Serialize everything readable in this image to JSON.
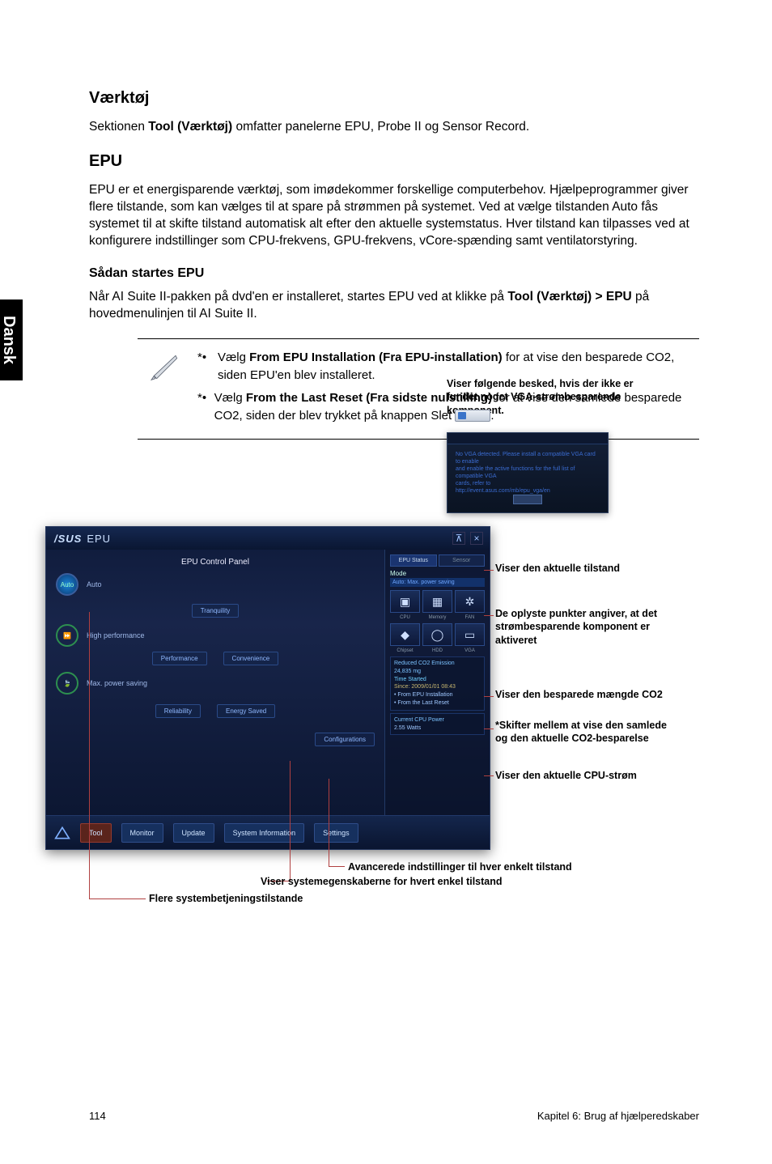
{
  "side_tab": "Dansk",
  "section1": {
    "heading": "Værktøj",
    "body_prefix": "Sektionen ",
    "body_bold": "Tool (Værktøj)",
    "body_suffix": " omfatter panelerne EPU, Probe II og Sensor Record."
  },
  "section2": {
    "heading": "EPU",
    "body": "EPU er et energisparende værktøj, som imødekommer forskellige computerbehov. Hjælpeprogrammer giver flere tilstande, som kan vælges til at spare på strømmen på systemet. Ved at vælge tilstanden Auto fås systemet til at skifte tilstand automatisk alt efter den aktuelle systemstatus. Hver tilstand kan tilpasses ved at konfigurere indstillinger som CPU-frekvens, GPU-frekvens, vCore-spænding samt ventilatorstyring."
  },
  "start": {
    "heading": "Sådan startes EPU",
    "p1_a": "Når AI Suite II-pakken på dvd'en er installeret, startes EPU ved at klikke på ",
    "p1_b": "Tool (Værktøj) > EPU",
    "p1_c": " på hovedmenulinjen til AI Suite II."
  },
  "callouts": {
    "top": "Viser følgende besked, hvis der ikke er fundet noget VGA-strømbesparende komponent.",
    "r1": "Viser den aktuelle tilstand",
    "r2": "De oplyste punkter angiver, at det strømbesparende komponent er aktiveret",
    "r3": "Viser den besparede mængde CO2",
    "r4": "*Skifter mellem at vise den samlede og den aktuelle CO2-besparelse",
    "r5": "Viser den aktuelle CPU-strøm",
    "b1": "Avancerede indstillinger til hver enkelt tilstand",
    "b2": "Viser systemegenskaberne for hvert enkel tilstand",
    "b3": "Flere systembetjeningstilstande"
  },
  "warn": {
    "line1": "No VGA detected. Please install a compatible VGA card to enable",
    "line2": "and enable the active functions for the full list of compatible VGA",
    "line3": "cards, refer to",
    "line4": "http://event.asus.com/mb/epu_vga/en"
  },
  "shot": {
    "brand": "/SUS",
    "title": "EPU",
    "panel_label": "EPU Control Panel",
    "mode_auto": "Auto",
    "mode_high": "High performance",
    "mode_max": "Max. power saving",
    "tag_tranquility": "Tranquility",
    "tag_performance": "Performance",
    "tag_convenience": "Convenience",
    "tag_reliability": "Reliability",
    "tag_energy": "Energy Saved",
    "tag_config": "Configurations",
    "rp_tab1": "EPU Status",
    "rp_tab2": "Sensor",
    "rp_mode": "Mode",
    "rp_auto": "Auto: Max. power saving",
    "rp_cap_cpu": "CPU",
    "rp_cap_mem": "Memory",
    "rp_cap_fan": "FAN",
    "rp_cap_chip": "Chipset",
    "rp_cap_hdd": "HDD",
    "rp_cap_vga": "VGA",
    "rp_co2_label": "Reduced CO2 Emission",
    "rp_co2_val": "24,835 mg",
    "rp_time_label": "Time Started",
    "rp_time_val": "Since: 2009/01/01 08:43",
    "rp_from1": "• From EPU Installation",
    "rp_from2": "• From the Last Reset",
    "rp_cpu_label": "Current CPU Power",
    "rp_cpu_val": "2.55 Watts",
    "bb_tool": "Tool",
    "bb_monitor": "Monitor",
    "bb_update": "Update",
    "bb_sys": "System Information",
    "bb_settings": "Settings"
  },
  "notes": {
    "n1_a": "Vælg ",
    "n1_b": "From EPU Installation (Fra EPU-installation)",
    "n1_c": " for at vise den besparede CO2, siden EPU'en blev installeret.",
    "n2_a": "Vælg ",
    "n2_b": "From the Last Reset (Fra sidste nulstilling)",
    "n2_c": " for at vise den samlede besparede CO2, siden der blev trykket på knappen Slet ",
    "n2_d": "."
  },
  "footer": {
    "page": "114",
    "chapter": "Kapitel 6: Brug af hjælperedskaber"
  }
}
